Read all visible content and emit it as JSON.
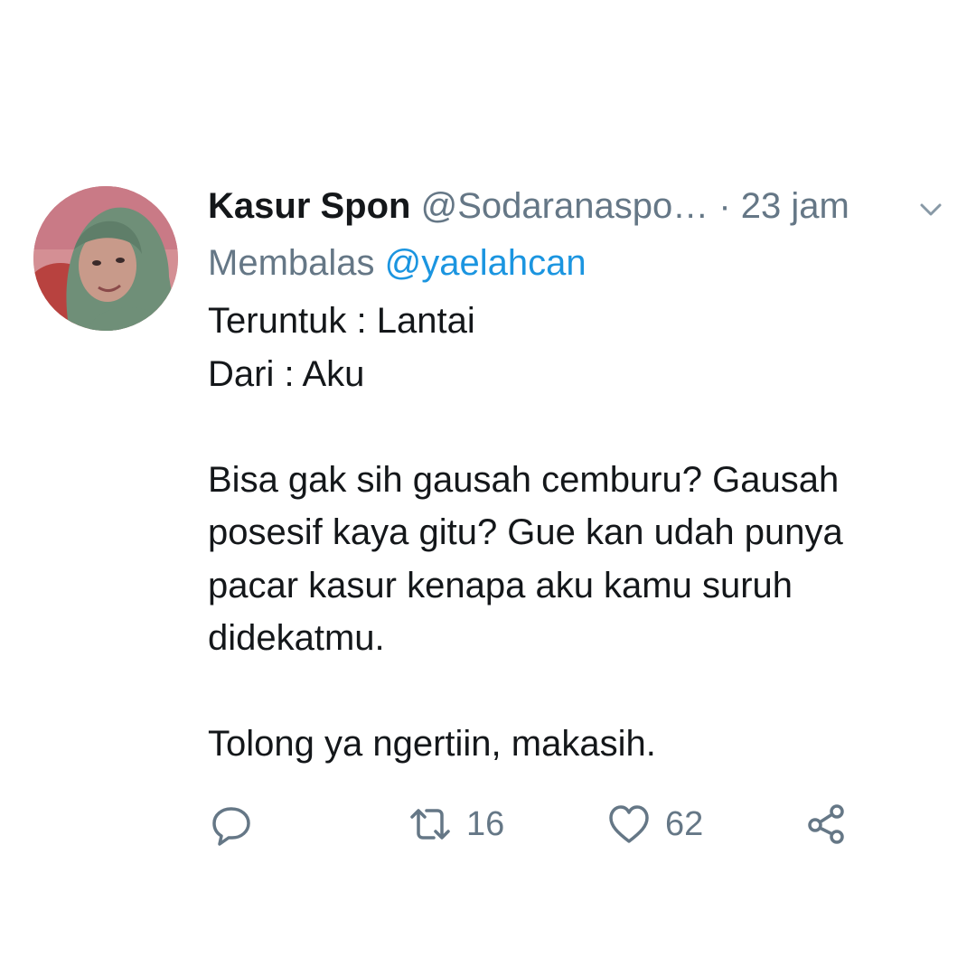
{
  "tweet": {
    "display_name": "Kasur Spon",
    "handle": "@Sodaranaspo…",
    "separator": "·",
    "time": "23 jam",
    "reply_prefix": "Membalas",
    "reply_target": "@yaelahcan",
    "body_lines": [
      "Teruntuk : Lantai",
      "Dari : Aku",
      "",
      "Bisa gak sih gausah cemburu? Gausah",
      "posesif kaya gitu? Gue kan udah punya",
      "pacar kasur kenapa aku kamu suruh",
      "didekatmu.",
      "",
      "Tolong ya ngertiin, makasih."
    ],
    "actions": {
      "reply_icon": "reply-icon",
      "retweet_icon": "retweet-icon",
      "retweet_count": "16",
      "like_icon": "heart-icon",
      "like_count": "62",
      "share_icon": "share-icon"
    }
  },
  "colors": {
    "text_primary": "#14171a",
    "text_secondary": "#657786",
    "link": "#1b95e0",
    "background": "#ffffff"
  }
}
